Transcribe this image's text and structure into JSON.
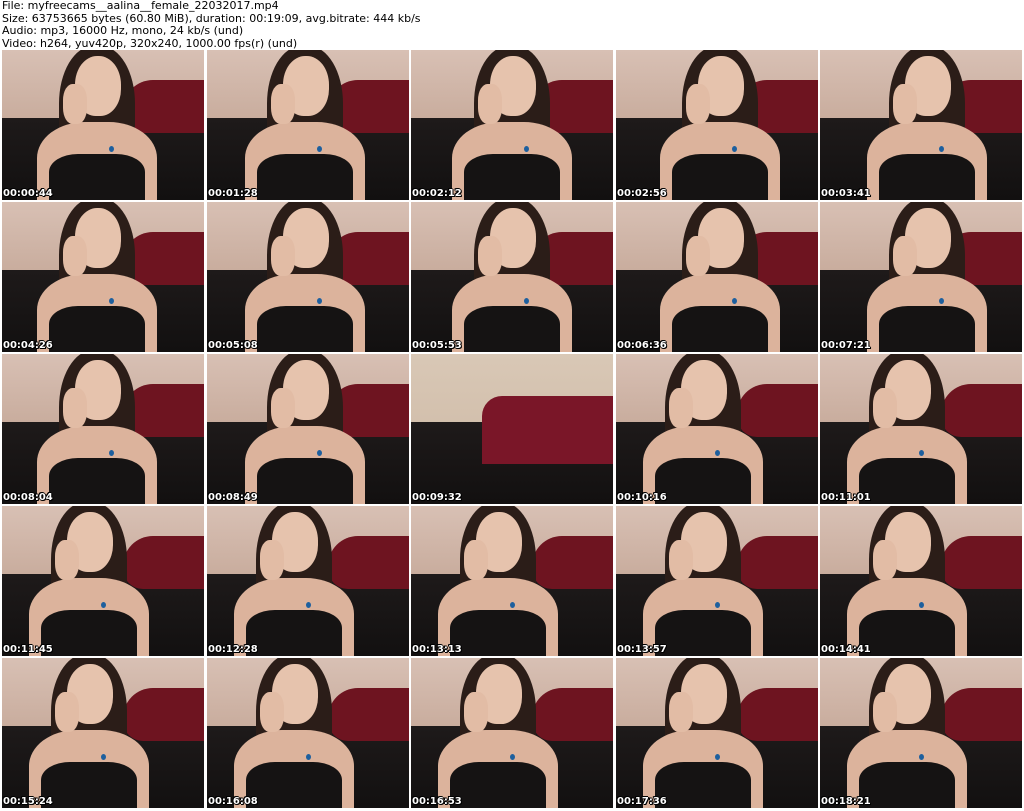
{
  "header": {
    "file_line": "File: myfreecams__aalina__female_22032017.mp4",
    "size_line": "Size: 63753665 bytes (60.80 MiB), duration: 00:19:09, avg.bitrate: 444 kb/s",
    "audio_line": "Audio: mp3, 16000 Hz, mono, 24 kb/s (und)",
    "video_line": "Video: h264, yuv420p, 320x240, 1000.00 fps(r) (und)"
  },
  "colors": {
    "background": "#ffffff",
    "timestamp_text": "#ffffff",
    "timestamp_outline": "#000000"
  },
  "thumbnails": [
    {
      "timestamp": "00:00:44"
    },
    {
      "timestamp": "00:01:28"
    },
    {
      "timestamp": "00:02:12"
    },
    {
      "timestamp": "00:02:56"
    },
    {
      "timestamp": "00:03:41"
    },
    {
      "timestamp": "00:04:26"
    },
    {
      "timestamp": "00:05:08"
    },
    {
      "timestamp": "00:05:53"
    },
    {
      "timestamp": "00:06:36"
    },
    {
      "timestamp": "00:07:21"
    },
    {
      "timestamp": "00:08:04"
    },
    {
      "timestamp": "00:08:49"
    },
    {
      "timestamp": "00:09:32"
    },
    {
      "timestamp": "00:10:16"
    },
    {
      "timestamp": "00:11:01"
    },
    {
      "timestamp": "00:11:45"
    },
    {
      "timestamp": "00:12:28"
    },
    {
      "timestamp": "00:13:13"
    },
    {
      "timestamp": "00:13:57"
    },
    {
      "timestamp": "00:14:41"
    },
    {
      "timestamp": "00:15:24"
    },
    {
      "timestamp": "00:16:08"
    },
    {
      "timestamp": "00:16:53"
    },
    {
      "timestamp": "00:17:36"
    },
    {
      "timestamp": "00:18:21"
    }
  ]
}
